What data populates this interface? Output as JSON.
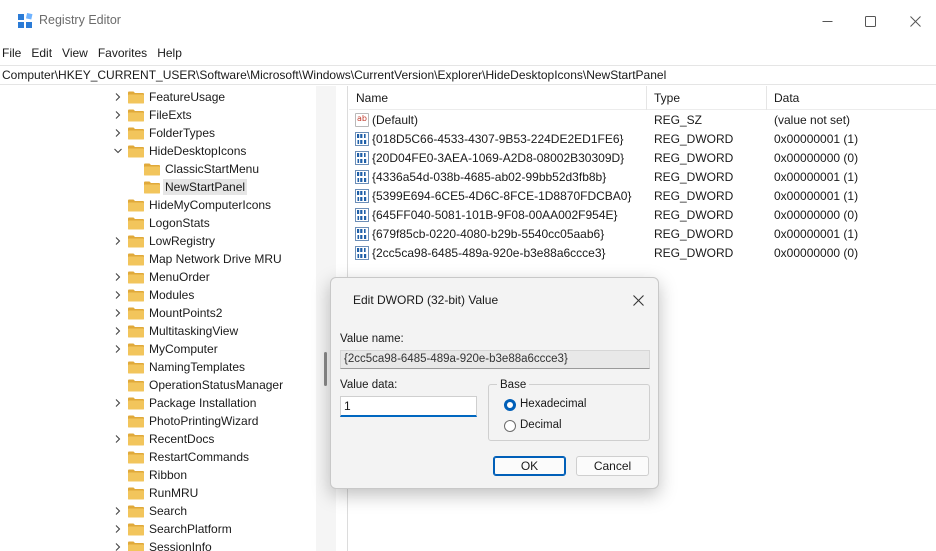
{
  "window": {
    "title": "Registry Editor",
    "controls": {
      "minimize": "minimize-icon",
      "maximize": "maximize-icon",
      "close": "close-icon"
    }
  },
  "menu": [
    "File",
    "Edit",
    "View",
    "Favorites",
    "Help"
  ],
  "address": "Computer\\HKEY_CURRENT_USER\\Software\\Microsoft\\Windows\\CurrentVersion\\Explorer\\HideDesktopIcons\\NewStartPanel",
  "tree": [
    {
      "label": "FeatureUsage",
      "level": 0,
      "expander": "collapsed"
    },
    {
      "label": "FileExts",
      "level": 0,
      "expander": "collapsed"
    },
    {
      "label": "FolderTypes",
      "level": 0,
      "expander": "collapsed"
    },
    {
      "label": "HideDesktopIcons",
      "level": 0,
      "expander": "expanded"
    },
    {
      "label": "ClassicStartMenu",
      "level": 1,
      "expander": "none"
    },
    {
      "label": "NewStartPanel",
      "level": 1,
      "expander": "none",
      "selected": true
    },
    {
      "label": "HideMyComputerIcons",
      "level": 0,
      "expander": "none"
    },
    {
      "label": "LogonStats",
      "level": 0,
      "expander": "none"
    },
    {
      "label": "LowRegistry",
      "level": 0,
      "expander": "collapsed"
    },
    {
      "label": "Map Network Drive MRU",
      "level": 0,
      "expander": "none"
    },
    {
      "label": "MenuOrder",
      "level": 0,
      "expander": "collapsed"
    },
    {
      "label": "Modules",
      "level": 0,
      "expander": "collapsed"
    },
    {
      "label": "MountPoints2",
      "level": 0,
      "expander": "collapsed"
    },
    {
      "label": "MultitaskingView",
      "level": 0,
      "expander": "collapsed"
    },
    {
      "label": "MyComputer",
      "level": 0,
      "expander": "collapsed"
    },
    {
      "label": "NamingTemplates",
      "level": 0,
      "expander": "none"
    },
    {
      "label": "OperationStatusManager",
      "level": 0,
      "expander": "none"
    },
    {
      "label": "Package Installation",
      "level": 0,
      "expander": "collapsed"
    },
    {
      "label": "PhotoPrintingWizard",
      "level": 0,
      "expander": "none"
    },
    {
      "label": "RecentDocs",
      "level": 0,
      "expander": "collapsed"
    },
    {
      "label": "RestartCommands",
      "level": 0,
      "expander": "none"
    },
    {
      "label": "Ribbon",
      "level": 0,
      "expander": "none"
    },
    {
      "label": "RunMRU",
      "level": 0,
      "expander": "none"
    },
    {
      "label": "Search",
      "level": 0,
      "expander": "collapsed"
    },
    {
      "label": "SearchPlatform",
      "level": 0,
      "expander": "collapsed"
    },
    {
      "label": "SessionInfo",
      "level": 0,
      "expander": "collapsed"
    }
  ],
  "values": {
    "columns": [
      "Name",
      "Type",
      "Data"
    ],
    "rows": [
      {
        "icon": "string-value-icon",
        "name": "(Default)",
        "type": "REG_SZ",
        "data": "(value not set)"
      },
      {
        "icon": "binary-value-icon",
        "name": "{018D5C66-4533-4307-9B53-224DE2ED1FE6}",
        "type": "REG_DWORD",
        "data": "0x00000001 (1)"
      },
      {
        "icon": "binary-value-icon",
        "name": "{20D04FE0-3AEA-1069-A2D8-08002B30309D}",
        "type": "REG_DWORD",
        "data": "0x00000000 (0)"
      },
      {
        "icon": "binary-value-icon",
        "name": "{4336a54d-038b-4685-ab02-99bb52d3fb8b}",
        "type": "REG_DWORD",
        "data": "0x00000001 (1)"
      },
      {
        "icon": "binary-value-icon",
        "name": "{5399E694-6CE5-4D6C-8FCE-1D8870FDCBA0}",
        "type": "REG_DWORD",
        "data": "0x00000001 (1)"
      },
      {
        "icon": "binary-value-icon",
        "name": "{645FF040-5081-101B-9F08-00AA002F954E}",
        "type": "REG_DWORD",
        "data": "0x00000000 (0)"
      },
      {
        "icon": "binary-value-icon",
        "name": "{679f85cb-0220-4080-b29b-5540cc05aab6}",
        "type": "REG_DWORD",
        "data": "0x00000001 (1)"
      },
      {
        "icon": "binary-value-icon",
        "name": "{2cc5ca98-6485-489a-920e-b3e88a6ccce3}",
        "type": "REG_DWORD",
        "data": "0x00000000 (0)",
        "selected": true
      }
    ]
  },
  "dialog": {
    "title": "Edit DWORD (32-bit) Value",
    "value_name_label": "Value name:",
    "value_name": "{2cc5ca98-6485-489a-920e-b3e88a6ccce3}",
    "value_data_label": "Value data:",
    "value_data": "1",
    "base_label": "Base",
    "base_options": [
      {
        "label": "Hexadecimal",
        "checked": true
      },
      {
        "label": "Decimal",
        "checked": false
      }
    ],
    "ok_label": "OK",
    "cancel_label": "Cancel"
  },
  "colors": {
    "folder": "#f2c55c",
    "accent": "#005fb8",
    "selection": "#e6e6e6"
  }
}
